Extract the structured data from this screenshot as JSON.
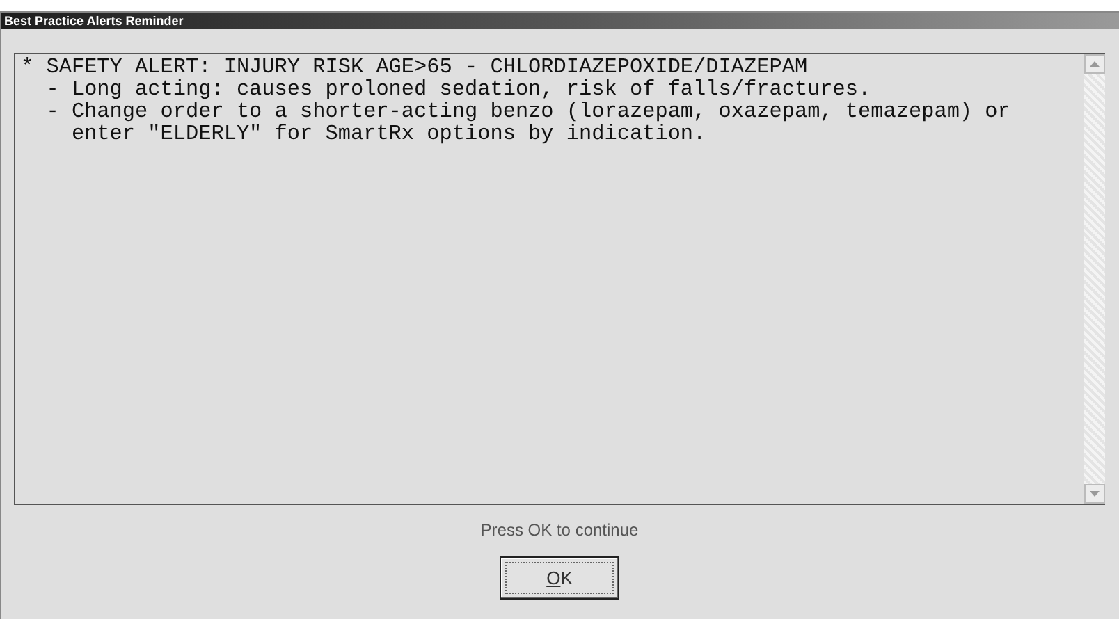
{
  "window": {
    "title": "Best Practice Alerts Reminder"
  },
  "alert_lines": [
    "* SAFETY ALERT: INJURY RISK AGE>65 - CHLORDIAZEPOXIDE/DIAZEPAM",
    "  - Long acting: causes proloned sedation, risk of falls/fractures.",
    "  - Change order to a shorter-acting benzo (lorazepam, oxazepam, temazepam) or",
    "    enter \"ELDERLY\" for SmartRx options by indication."
  ],
  "prompt": "Press OK to continue",
  "buttons": [
    "OK"
  ]
}
